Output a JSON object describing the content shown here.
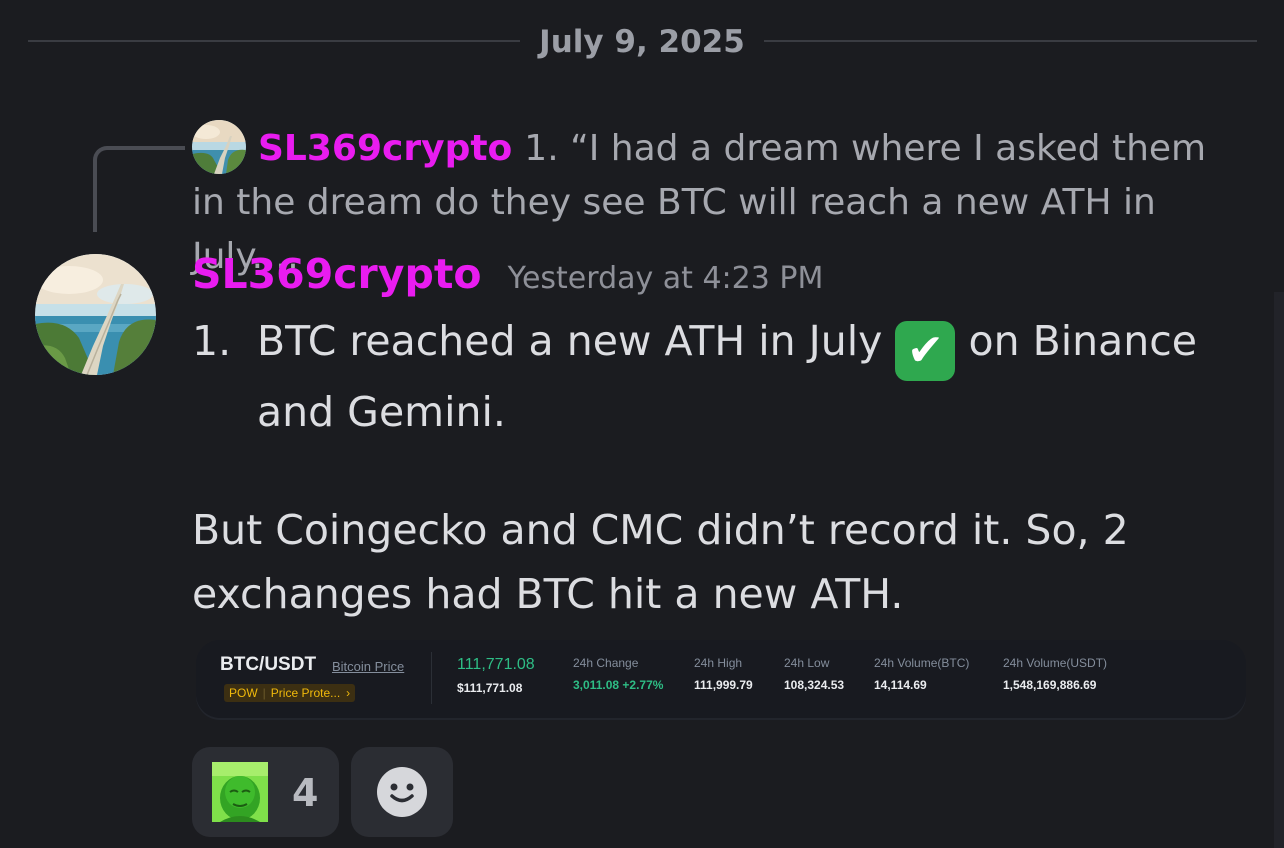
{
  "divider": {
    "date": "July 9, 2025"
  },
  "reply": {
    "author": "SL369crypto",
    "preview": "1.  “I had a dream where I asked them in the dream do they see BTC will reach a new ATH in July.…"
  },
  "message": {
    "author": "SL369crypto",
    "timestamp": "Yesterday at 4:23 PM",
    "list_number": "1.",
    "list_text_before": "BTC reached a new ATH in July",
    "list_emoji": "✔",
    "list_text_after": "on Binance and Gemini.",
    "paragraph": "But Coingecko and CMC didn’t record it. So, 2 exchanges had BTC hit a new ATH."
  },
  "ticker": {
    "pair": "BTC/USDT",
    "link": "Bitcoin Price",
    "tag1": "POW",
    "tag2": "Price Prote...",
    "tag_arrow": "›",
    "price": "111,771.08",
    "price_usd": "$111,771.08",
    "stats": [
      {
        "label": "24h Change",
        "value": "3,011.08 +2.77%"
      },
      {
        "label": "24h High",
        "value": "111,999.79"
      },
      {
        "label": "24h Low",
        "value": "108,324.53"
      },
      {
        "label": "24h Volume(BTC)",
        "value": "14,114.69"
      },
      {
        "label": "24h Volume(USDT)",
        "value": "1,548,169,886.69"
      }
    ]
  },
  "reactions": {
    "pepe_count": "4",
    "pepe_icon": "pepe-emoji-icon",
    "add_icon": "add-reaction-smile-icon"
  },
  "colors": {
    "background": "#1b1c20",
    "author": "#e91cf0",
    "up": "#2ebd85"
  }
}
